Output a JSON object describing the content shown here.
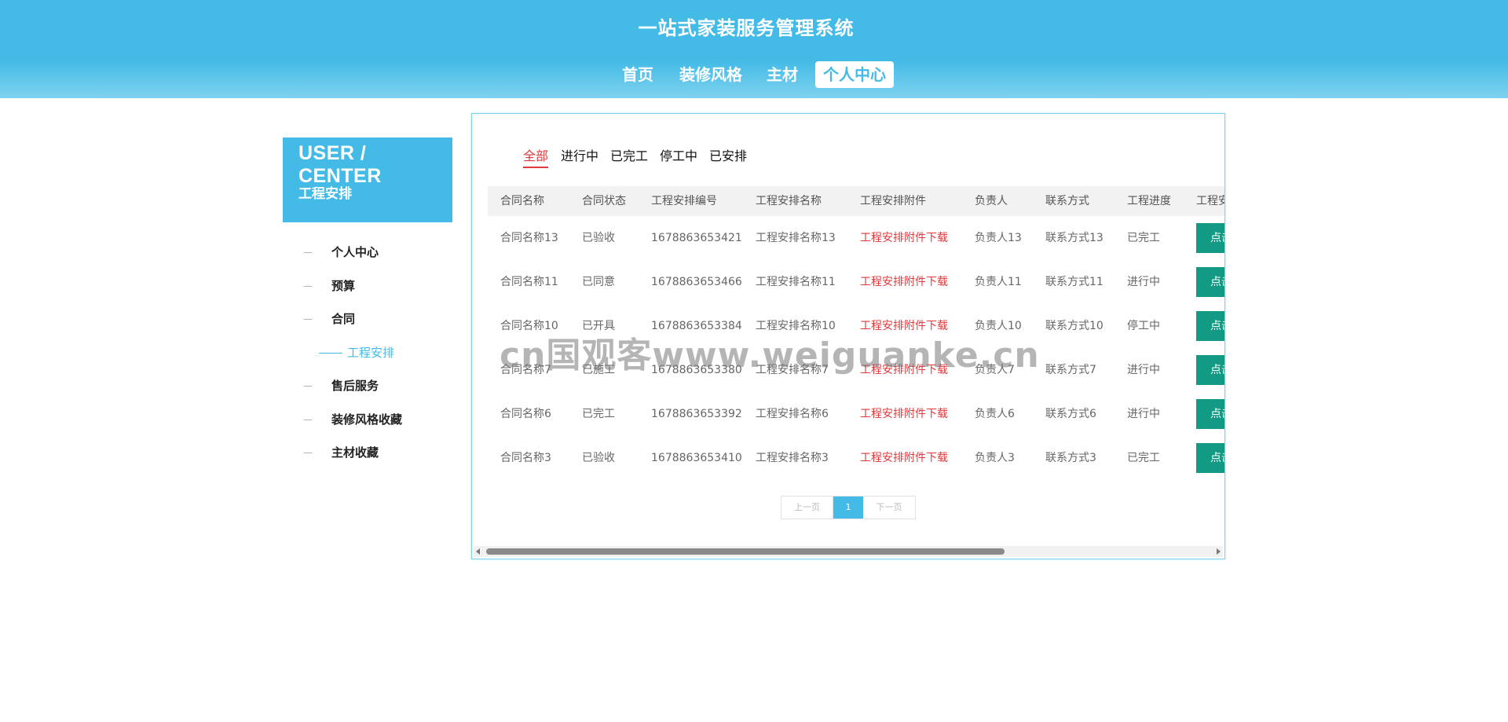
{
  "site": {
    "title": "一站式家装服务管理系统"
  },
  "nav": [
    {
      "label": "首页"
    },
    {
      "label": "装修风格"
    },
    {
      "label": "主材"
    },
    {
      "label": "个人中心"
    }
  ],
  "sidebar": {
    "heading": "USER / CENTER",
    "current": "工程安排",
    "items": [
      {
        "label": "个人中心"
      },
      {
        "label": "预算"
      },
      {
        "label": "合同"
      },
      {
        "label": "工程安排"
      },
      {
        "label": "售后服务"
      },
      {
        "label": "装修风格收藏"
      },
      {
        "label": "主材收藏"
      }
    ]
  },
  "tabs": [
    {
      "label": "全部"
    },
    {
      "label": "进行中"
    },
    {
      "label": "已完工"
    },
    {
      "label": "停工中"
    },
    {
      "label": "已安排"
    }
  ],
  "table": {
    "headers": [
      "合同名称",
      "合同状态",
      "工程安排编号",
      "工程安排名称",
      "工程安排附件",
      "负责人",
      "联系方式",
      "工程进度",
      "工程安"
    ],
    "action_label": "点击",
    "rows": [
      [
        "合同名称13",
        "已验收",
        "1678863653421",
        "工程安排名称13",
        "工程安排附件下载",
        "负责人13",
        "联系方式13",
        "已完工"
      ],
      [
        "合同名称11",
        "已同意",
        "1678863653466",
        "工程安排名称11",
        "工程安排附件下载",
        "负责人11",
        "联系方式11",
        "进行中"
      ],
      [
        "合同名称10",
        "已开具",
        "1678863653384",
        "工程安排名称10",
        "工程安排附件下载",
        "负责人10",
        "联系方式10",
        "停工中"
      ],
      [
        "合同名称7",
        "已施工",
        "1678863653380",
        "工程安排名称7",
        "工程安排附件下载",
        "负责人7",
        "联系方式7",
        "进行中"
      ],
      [
        "合同名称6",
        "已完工",
        "1678863653392",
        "工程安排名称6",
        "工程安排附件下载",
        "负责人6",
        "联系方式6",
        "进行中"
      ],
      [
        "合同名称3",
        "已验收",
        "1678863653410",
        "工程安排名称3",
        "工程安排附件下载",
        "负责人3",
        "联系方式3",
        "已完工"
      ]
    ]
  },
  "pager": {
    "prev": "上一页",
    "current": "1",
    "next": "下一页"
  },
  "watermark": "cn国观客www.weiguanke.cn",
  "colors": {
    "accent": "#44bbe6",
    "link": "#e4393c",
    "action": "#139a84"
  }
}
